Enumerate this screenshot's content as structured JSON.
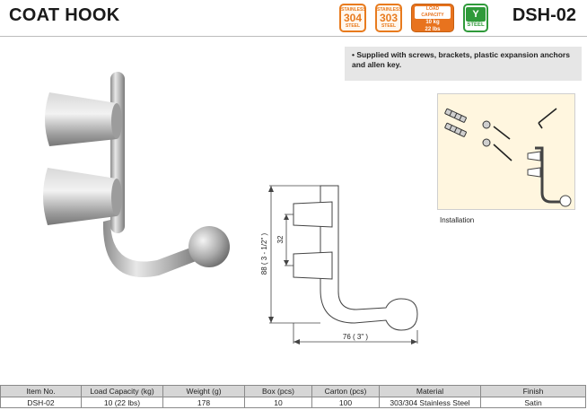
{
  "header": {
    "title": "COAT HOOK",
    "model_code": "DSH-02"
  },
  "badges": {
    "stainless_304": {
      "top": "STAINLESS",
      "number": "304",
      "bottom": "STEEL"
    },
    "stainless_303": {
      "top": "STAINLESS",
      "number": "303",
      "bottom": "STEEL"
    },
    "load_capacity": {
      "heading": "LOAD CAPACITY",
      "line1": "10 kg",
      "line2": "22 lbs"
    },
    "steel": {
      "symbol": "Y",
      "label": "STEEL"
    }
  },
  "colors": {
    "stainless_orange": "#e87b1e",
    "steel_green": "#2f9a3a",
    "note_bg": "#e6e6e6",
    "install_bg": "#fff6df"
  },
  "note": {
    "text": "• Supplied with screws, brackets, plastic expansion anchors and allen key."
  },
  "installation": {
    "label": "Installation"
  },
  "dimensions": {
    "height": "88 ( 3 - 1/2\" )",
    "spacing": "32",
    "width": "76 ( 3\" )"
  },
  "specs_table": {
    "headers": [
      "Item No.",
      "Load Capacity (kg)",
      "Weight (g)",
      "Box (pcs)",
      "Carton (pcs)"
    ],
    "row": [
      "DSH-02",
      "10 (22 lbs)",
      "178",
      "10",
      "100"
    ]
  },
  "material_table": {
    "headers": [
      "Material",
      "Finish"
    ],
    "row": [
      "303/304 Stainless Steel",
      "Satin"
    ]
  }
}
